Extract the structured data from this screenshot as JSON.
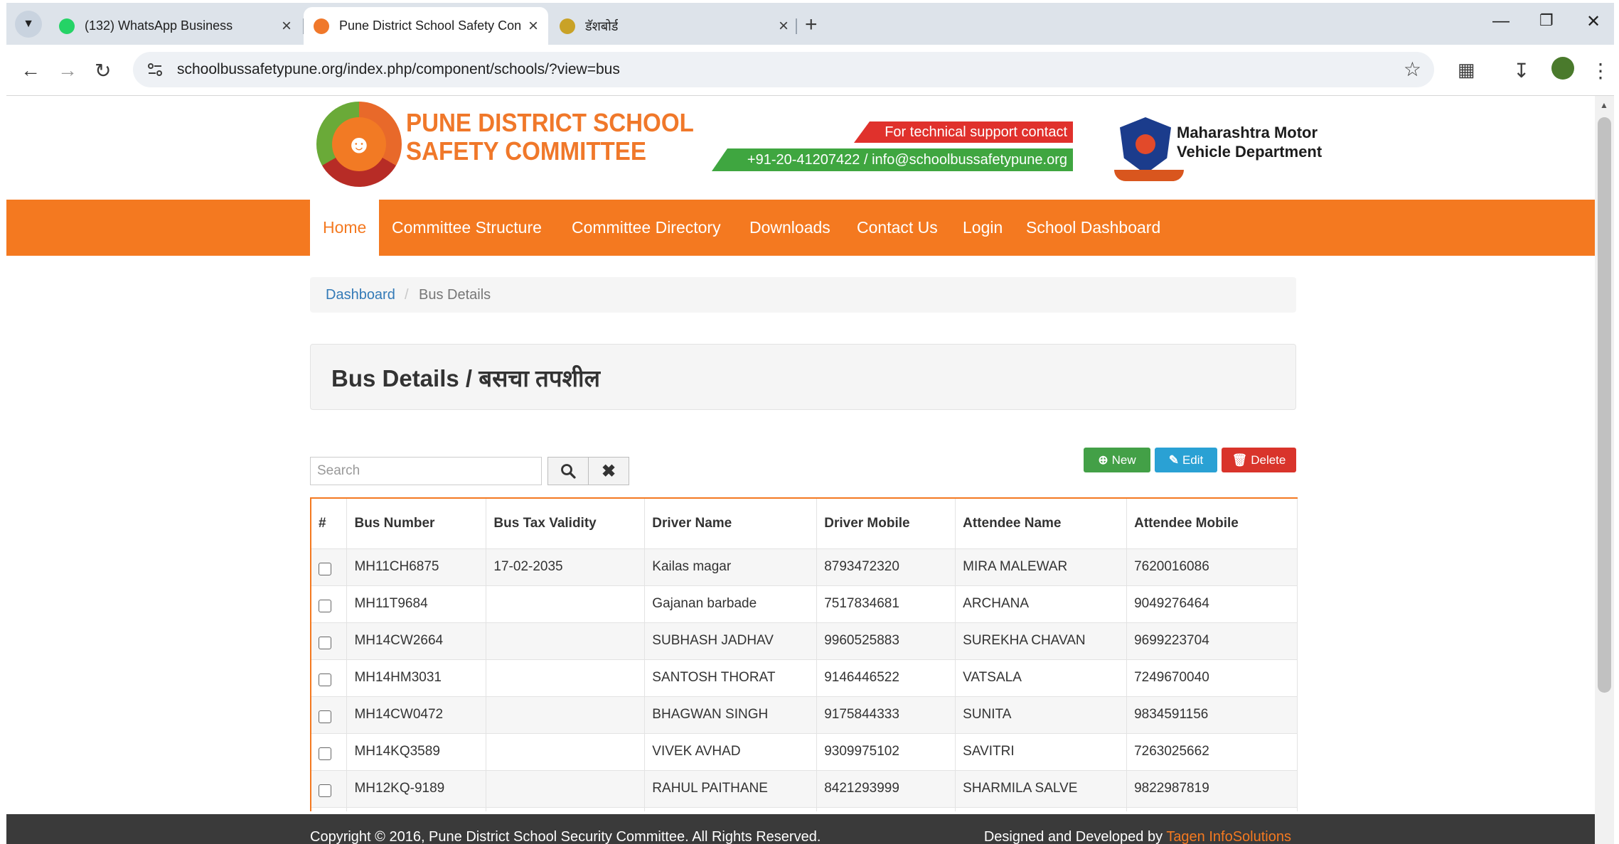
{
  "browser": {
    "tabs": [
      {
        "label": "(132) WhatsApp Business",
        "icon": "whatsapp-icon"
      },
      {
        "label": "Pune District School Safety Con",
        "icon": "site-favicon"
      },
      {
        "label": "डॅशबोर्ड",
        "icon": "dashboard-favicon"
      }
    ],
    "new_tab": "+",
    "url": "schoolbussafetypune.org/index.php/component/schools/?view=bus"
  },
  "header": {
    "org_line1": "PUNE DISTRICT SCHOOL",
    "org_line2": "SAFETY COMMITTEE",
    "support_label": "For technical support contact",
    "support_contact": "+91-20-41207422 / info@schoolbussafetypune.org",
    "mmvd_line1": "Maharashtra Motor",
    "mmvd_line2": "Vehicle Department"
  },
  "nav": {
    "items": [
      "Home",
      "Committee Structure",
      "Committee Directory",
      "Downloads",
      "Contact Us",
      "Login",
      "School Dashboard"
    ]
  },
  "breadcrumb": {
    "link": "Dashboard",
    "separator": "/",
    "current": "Bus Details"
  },
  "page_title": "Bus Details / बसचा तपशील",
  "search": {
    "placeholder": "Search"
  },
  "actions": {
    "new": "New",
    "edit": "Edit",
    "delete": "Delete"
  },
  "table": {
    "headers": [
      "#",
      "Bus Number",
      "Bus Tax Validity",
      "Driver Name",
      "Driver Mobile",
      "Attendee Name",
      "Attendee Mobile"
    ],
    "rows": [
      [
        "MH11CH6875",
        "17-02-2035",
        "Kailas magar",
        "8793472320",
        "MIRA MALEWAR",
        "7620016086"
      ],
      [
        "MH11T9684",
        "",
        "Gajanan barbade",
        "7517834681",
        "ARCHANA",
        "9049276464"
      ],
      [
        "MH14CW2664",
        "",
        "SUBHASH JADHAV",
        "9960525883",
        "SUREKHA CHAVAN",
        "9699223704"
      ],
      [
        "MH14HM3031",
        "",
        "SANTOSH THORAT",
        "9146446522",
        "VATSALA",
        "7249670040"
      ],
      [
        "MH14CW0472",
        "",
        "BHAGWAN SINGH",
        "9175844333",
        "SUNITA",
        "9834591156"
      ],
      [
        "MH14KQ3589",
        "",
        "VIVEK AVHAD",
        "9309975102",
        "SAVITRI",
        "7263025662"
      ],
      [
        "MH12KQ-9189",
        "",
        "RAHUL PAITHANE",
        "8421293999",
        "SHARMILA SALVE",
        "9822987819"
      ]
    ]
  },
  "footer": {
    "copyright": "Copyright © 2016, Pune District School Security Committee. All Rights Reserved.",
    "designed_by": "Designed and Developed by",
    "developer": "Tagen InfoSolutions"
  },
  "colors": {
    "brand_orange": "#f47920",
    "new_green": "#43a047",
    "edit_blue": "#2aa1d4",
    "delete_red": "#d9342b",
    "footer_bg": "#3a3a3a"
  }
}
